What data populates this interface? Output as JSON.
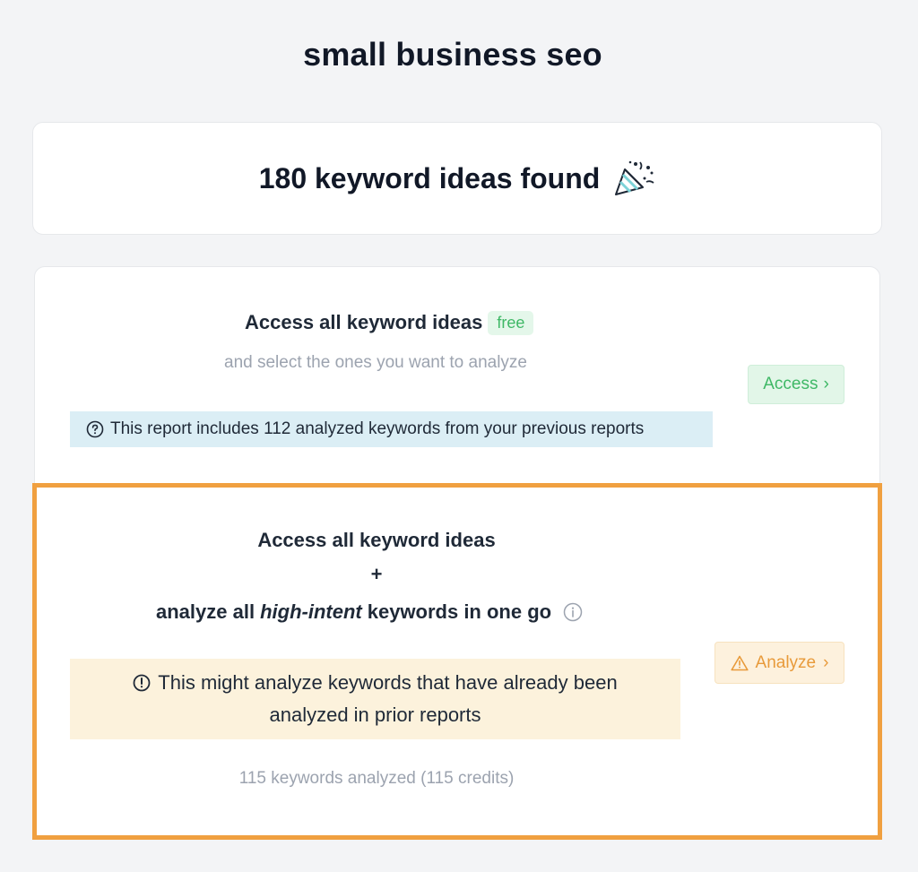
{
  "page": {
    "title": "small business seo"
  },
  "summary": {
    "found_text": "180 keyword ideas found",
    "icon": "party-popper-icon"
  },
  "option_access": {
    "title": "Access all keyword ideas",
    "badge": "free",
    "subtitle": "and select the ones you want to analyze",
    "button_label": "Access",
    "button_chevron": "›",
    "info_text": "This report includes 112 analyzed keywords from your previous reports",
    "info_icon": "question-circle-icon"
  },
  "option_analyze": {
    "line1": "Access all keyword ideas",
    "plus": "+",
    "line3_prefix": "analyze all",
    "line3_emphasis": "high-intent",
    "line3_suffix": "keywords in one go",
    "info_icon": "info-circle-icon",
    "button_label": "Analyze",
    "button_chevron": "›",
    "button_icon": "warning-triangle-icon",
    "warning_line1": "This might analyze keywords that have already been",
    "warning_line2": "analyzed in prior reports",
    "warning_icon": "exclamation-circle-icon",
    "credits_text": "115 keywords analyzed (115 credits)"
  },
  "colors": {
    "accent_green": "#3fb866",
    "accent_orange": "#e89a3a",
    "highlight_border": "#f0a040",
    "info_bg": "#dbeef5",
    "warning_bg": "#fcf2dc"
  }
}
